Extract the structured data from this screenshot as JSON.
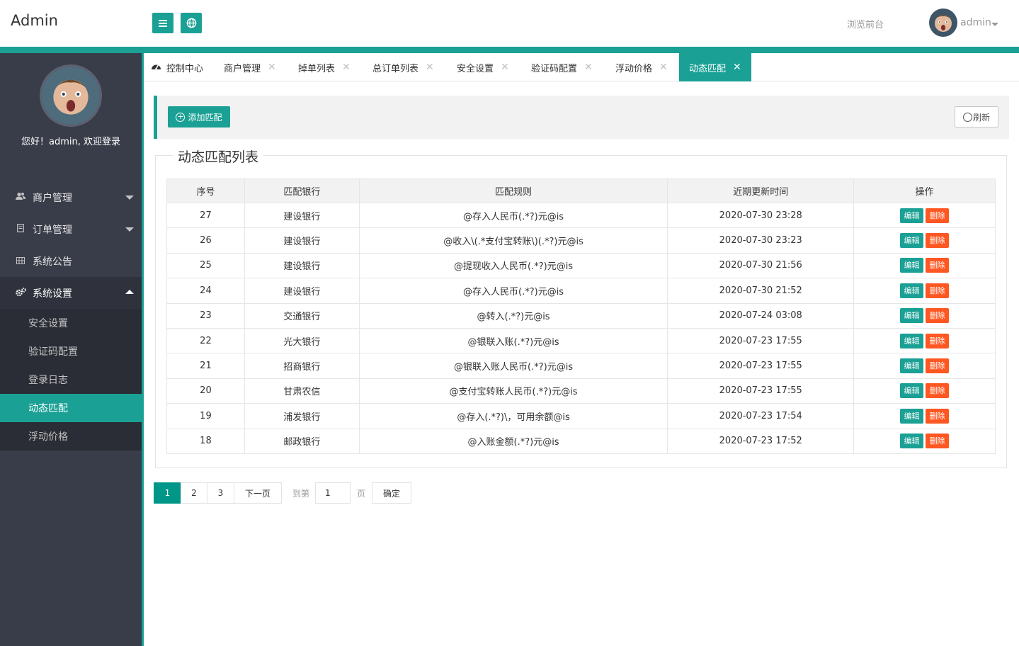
{
  "header": {
    "logo": "Admin",
    "front_link": "浏览前台",
    "user_name": "admin"
  },
  "sidebar": {
    "welcome": "您好！admin, 欢迎登录",
    "menu": [
      {
        "label": "商户管理",
        "icon": "users-icon"
      },
      {
        "label": "订单管理",
        "icon": "document-icon"
      },
      {
        "label": "系统公告",
        "icon": "grid-icon"
      },
      {
        "label": "系统设置",
        "icon": "gears-icon"
      }
    ],
    "sub_items": [
      "安全设置",
      "验证码配置",
      "登录日志",
      "动态匹配",
      "浮动价格"
    ]
  },
  "tabs": [
    {
      "label": "控制中心"
    },
    {
      "label": "商户管理"
    },
    {
      "label": "掉单列表"
    },
    {
      "label": "总订单列表"
    },
    {
      "label": "安全设置"
    },
    {
      "label": "验证码配置"
    },
    {
      "label": "浮动价格"
    },
    {
      "label": "动态匹配"
    }
  ],
  "toolbar": {
    "add_label": "添加匹配",
    "refresh_label": "刷新"
  },
  "panel_title": "动态匹配列表",
  "table": {
    "headers": [
      "序号",
      "匹配银行",
      "匹配规则",
      "近期更新时间",
      "操作"
    ],
    "edit_label": "编辑",
    "delete_label": "删除",
    "rows": [
      [
        "27",
        "建设银行",
        "@存入人民币(.*?)元@is",
        "2020-07-30 23:28"
      ],
      [
        "26",
        "建设银行",
        "@收入\\(.*支付宝转账\\)(.*?)元@is",
        "2020-07-30 23:23"
      ],
      [
        "25",
        "建设银行",
        "@提现收入人民币(.*?)元@is",
        "2020-07-30 21:56"
      ],
      [
        "24",
        "建设银行",
        "@存入人民币(.*?)元@is",
        "2020-07-30 21:52"
      ],
      [
        "23",
        "交通银行",
        "@转入(.*?)元@is",
        "2020-07-24 03:08"
      ],
      [
        "22",
        "光大银行",
        "@银联入账(.*?)元@is",
        "2020-07-23 17:55"
      ],
      [
        "21",
        "招商银行",
        "@银联入账人民币(.*?)元@is",
        "2020-07-23 17:55"
      ],
      [
        "20",
        "甘肃农信",
        "@支付宝转账人民币(.*?)元@is",
        "2020-07-23 17:55"
      ],
      [
        "19",
        "浦发银行",
        "@存入(.*?)\\，可用余额@is",
        "2020-07-23 17:54"
      ],
      [
        "18",
        "邮政银行",
        "@入账金额(.*?)元@is",
        "2020-07-23 17:52"
      ]
    ]
  },
  "pager": {
    "pages": [
      "1",
      "2",
      "3"
    ],
    "current": "1",
    "next_label": "下一页",
    "goto_label": "到第",
    "goto_value": "1",
    "page_suffix": "页",
    "confirm_label": "确定"
  },
  "colors": {
    "accent": "#1aa094",
    "sidebar_bg": "#393d49",
    "delete": "#ff5722"
  }
}
